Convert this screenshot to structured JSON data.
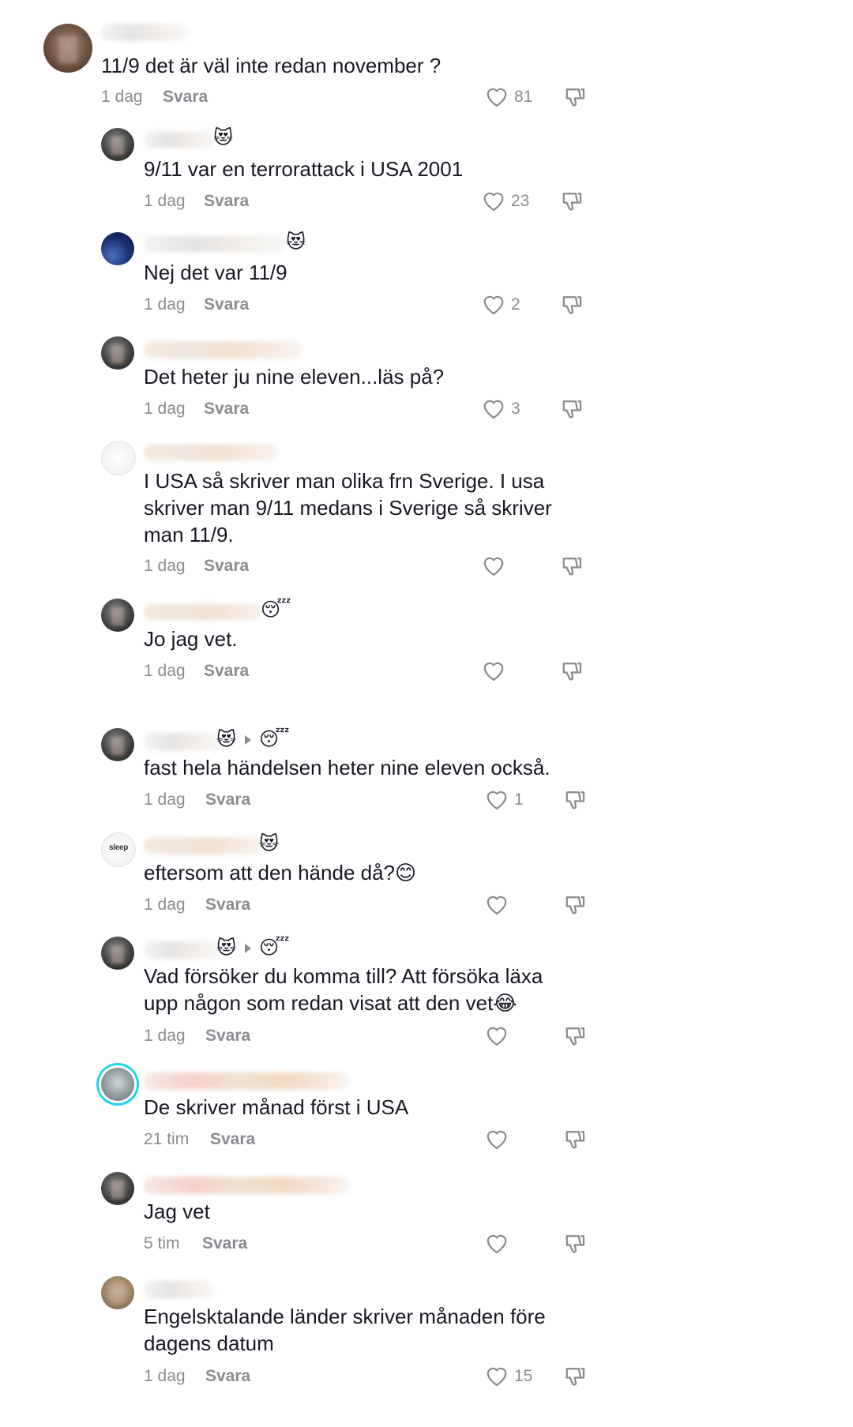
{
  "comments": [
    {
      "text": "11/9 det är väl inte redan november ?",
      "time": "1 dag",
      "reply_label": "Svara",
      "likes": "81",
      "reply_emoji": ""
    },
    {
      "text": "9/11 var en terrorattack i USA 2001",
      "time": "1 dag",
      "reply_label": "Svara",
      "likes": "23",
      "name_emoji": "😻"
    },
    {
      "text": "Nej det var 11/9",
      "time": "1 dag",
      "reply_label": "Svara",
      "likes": "2",
      "name_emoji": "😻"
    },
    {
      "text": "Det heter ju nine eleven...läs på?",
      "time": "1 dag",
      "reply_label": "Svara",
      "likes": "3"
    },
    {
      "text": "I USA så skriver man olika frn Sverige. I usa\nskriver man 9/11 medans i Sverige så skriver\nman 11/9.",
      "time": "1 dag",
      "reply_label": "Svara",
      "likes": ""
    },
    {
      "text": "Jo jag vet.",
      "time": "1 dag",
      "reply_label": "Svara",
      "likes": "",
      "name_emoji": "😴"
    },
    {
      "text": "fast hela händelsen heter nine eleven också.",
      "time": "1 dag",
      "reply_label": "Svara",
      "likes": "1",
      "name_emoji": "😻",
      "reply_to_emoji": "😴"
    },
    {
      "text": "eftersom att den hände då?😊",
      "time": "1 dag",
      "reply_label": "Svara",
      "likes": "",
      "name_emoji": "😻",
      "avatar_text": "sleep"
    },
    {
      "text": "Vad försöker du komma till? Att försöka läxa\nupp någon som redan visat att den vet😂",
      "time": "1 dag",
      "reply_label": "Svara",
      "likes": "",
      "name_emoji": "😻",
      "reply_to_emoji": "😴"
    },
    {
      "text": "De skriver månad först i USA",
      "time": "21 tim",
      "reply_label": "Svara",
      "likes": ""
    },
    {
      "text": "Jag vet",
      "time": "5 tim",
      "reply_label": "Svara",
      "likes": ""
    },
    {
      "text": "Engelsktalande länder skriver månaden före\ndagens datum",
      "time": "1 dag",
      "reply_label": "Svara",
      "likes": "15"
    }
  ],
  "icons": {
    "like": "heart-outline-icon",
    "dislike": "thumbs-down-outline-icon"
  },
  "colors": {
    "text": "#161823",
    "meta": "#8a8b91",
    "ring": "#20d5ec"
  }
}
